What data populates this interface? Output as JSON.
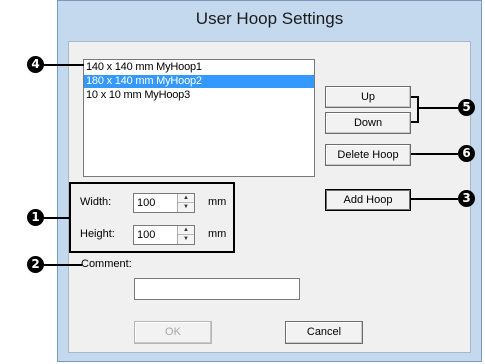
{
  "dialog": {
    "title": "User Hoop Settings"
  },
  "hoop_list": {
    "items": [
      {
        "label": "140 x 140 mm MyHoop1",
        "selected": false
      },
      {
        "label": "180 x 140 mm MyHoop2",
        "selected": true
      },
      {
        "label": "10 x 10 mm MyHoop3",
        "selected": false
      }
    ]
  },
  "buttons": {
    "up": "Up",
    "down": "Down",
    "delete_hoop": "Delete Hoop",
    "add_hoop": "Add Hoop",
    "ok": "OK",
    "cancel": "Cancel"
  },
  "size": {
    "width_label": "Width:",
    "width_value": "100",
    "height_label": "Height:",
    "height_value": "100",
    "unit": "mm"
  },
  "comment": {
    "label": "Comment:",
    "value": ""
  },
  "callouts": {
    "c1": "1",
    "c2": "2",
    "c3": "3",
    "c4": "4",
    "c5": "5",
    "c6": "6"
  },
  "icons": {
    "spin_up": "▲",
    "spin_down": "▼"
  }
}
